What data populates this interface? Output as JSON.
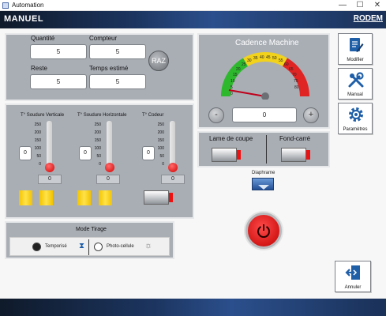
{
  "window": {
    "title": "Automation",
    "minimize": "—",
    "maximize": "☐",
    "close": "✕"
  },
  "header": {
    "mode_label": "MANUEL",
    "brand": "RODEM"
  },
  "counters": {
    "quantite_label": "Quantité",
    "quantite_value": "5",
    "compteur_label": "Compteur",
    "compteur_value": "5",
    "reste_label": "Reste",
    "reste_value": "5",
    "temps_label": "Temps estimé",
    "temps_value": "5",
    "raz_label": "RAZ"
  },
  "temperatures": {
    "ticks": [
      "250",
      "200",
      "150",
      "100",
      "50",
      "0"
    ],
    "columns": [
      {
        "title": "T° Soudure Verticale",
        "input": "0",
        "value": "0"
      },
      {
        "title": "T° Soudure Horizontale",
        "input": "0",
        "value": "0"
      },
      {
        "title": "T° Codeur",
        "input": "0",
        "value": "0"
      }
    ]
  },
  "mode_tirage": {
    "title": "Mode Tirage",
    "option_temporise": "Temporisé",
    "option_photo": "Photo-cellule",
    "selected": "Temporisé"
  },
  "cadence": {
    "title": "Cadence Machine",
    "scale": [
      "0",
      "5",
      "10",
      "15",
      "20",
      "25",
      "30",
      "35",
      "40",
      "45",
      "50",
      "55",
      "60",
      "65",
      "70",
      "75",
      "80"
    ],
    "value": "0",
    "minus": "-",
    "plus": "+",
    "gauge_colors": {
      "green": "#2db82d",
      "yellow": "#f2d21b",
      "red": "#e02424"
    }
  },
  "lame": {
    "lame_label": "Lame de coupe",
    "fond_label": "Fond-carré"
  },
  "diaphragme": {
    "label": "Diaphrame"
  },
  "side_buttons": {
    "modifier": "Modifier",
    "manual": "Manual",
    "parametres": "Paramètres",
    "annuler": "Annuler"
  },
  "colors": {
    "header_dark": "#1c3560",
    "panel_gray": "#a9aeb5",
    "accent_blue": "#1f5fa8",
    "stop_red": "#e0201f"
  }
}
